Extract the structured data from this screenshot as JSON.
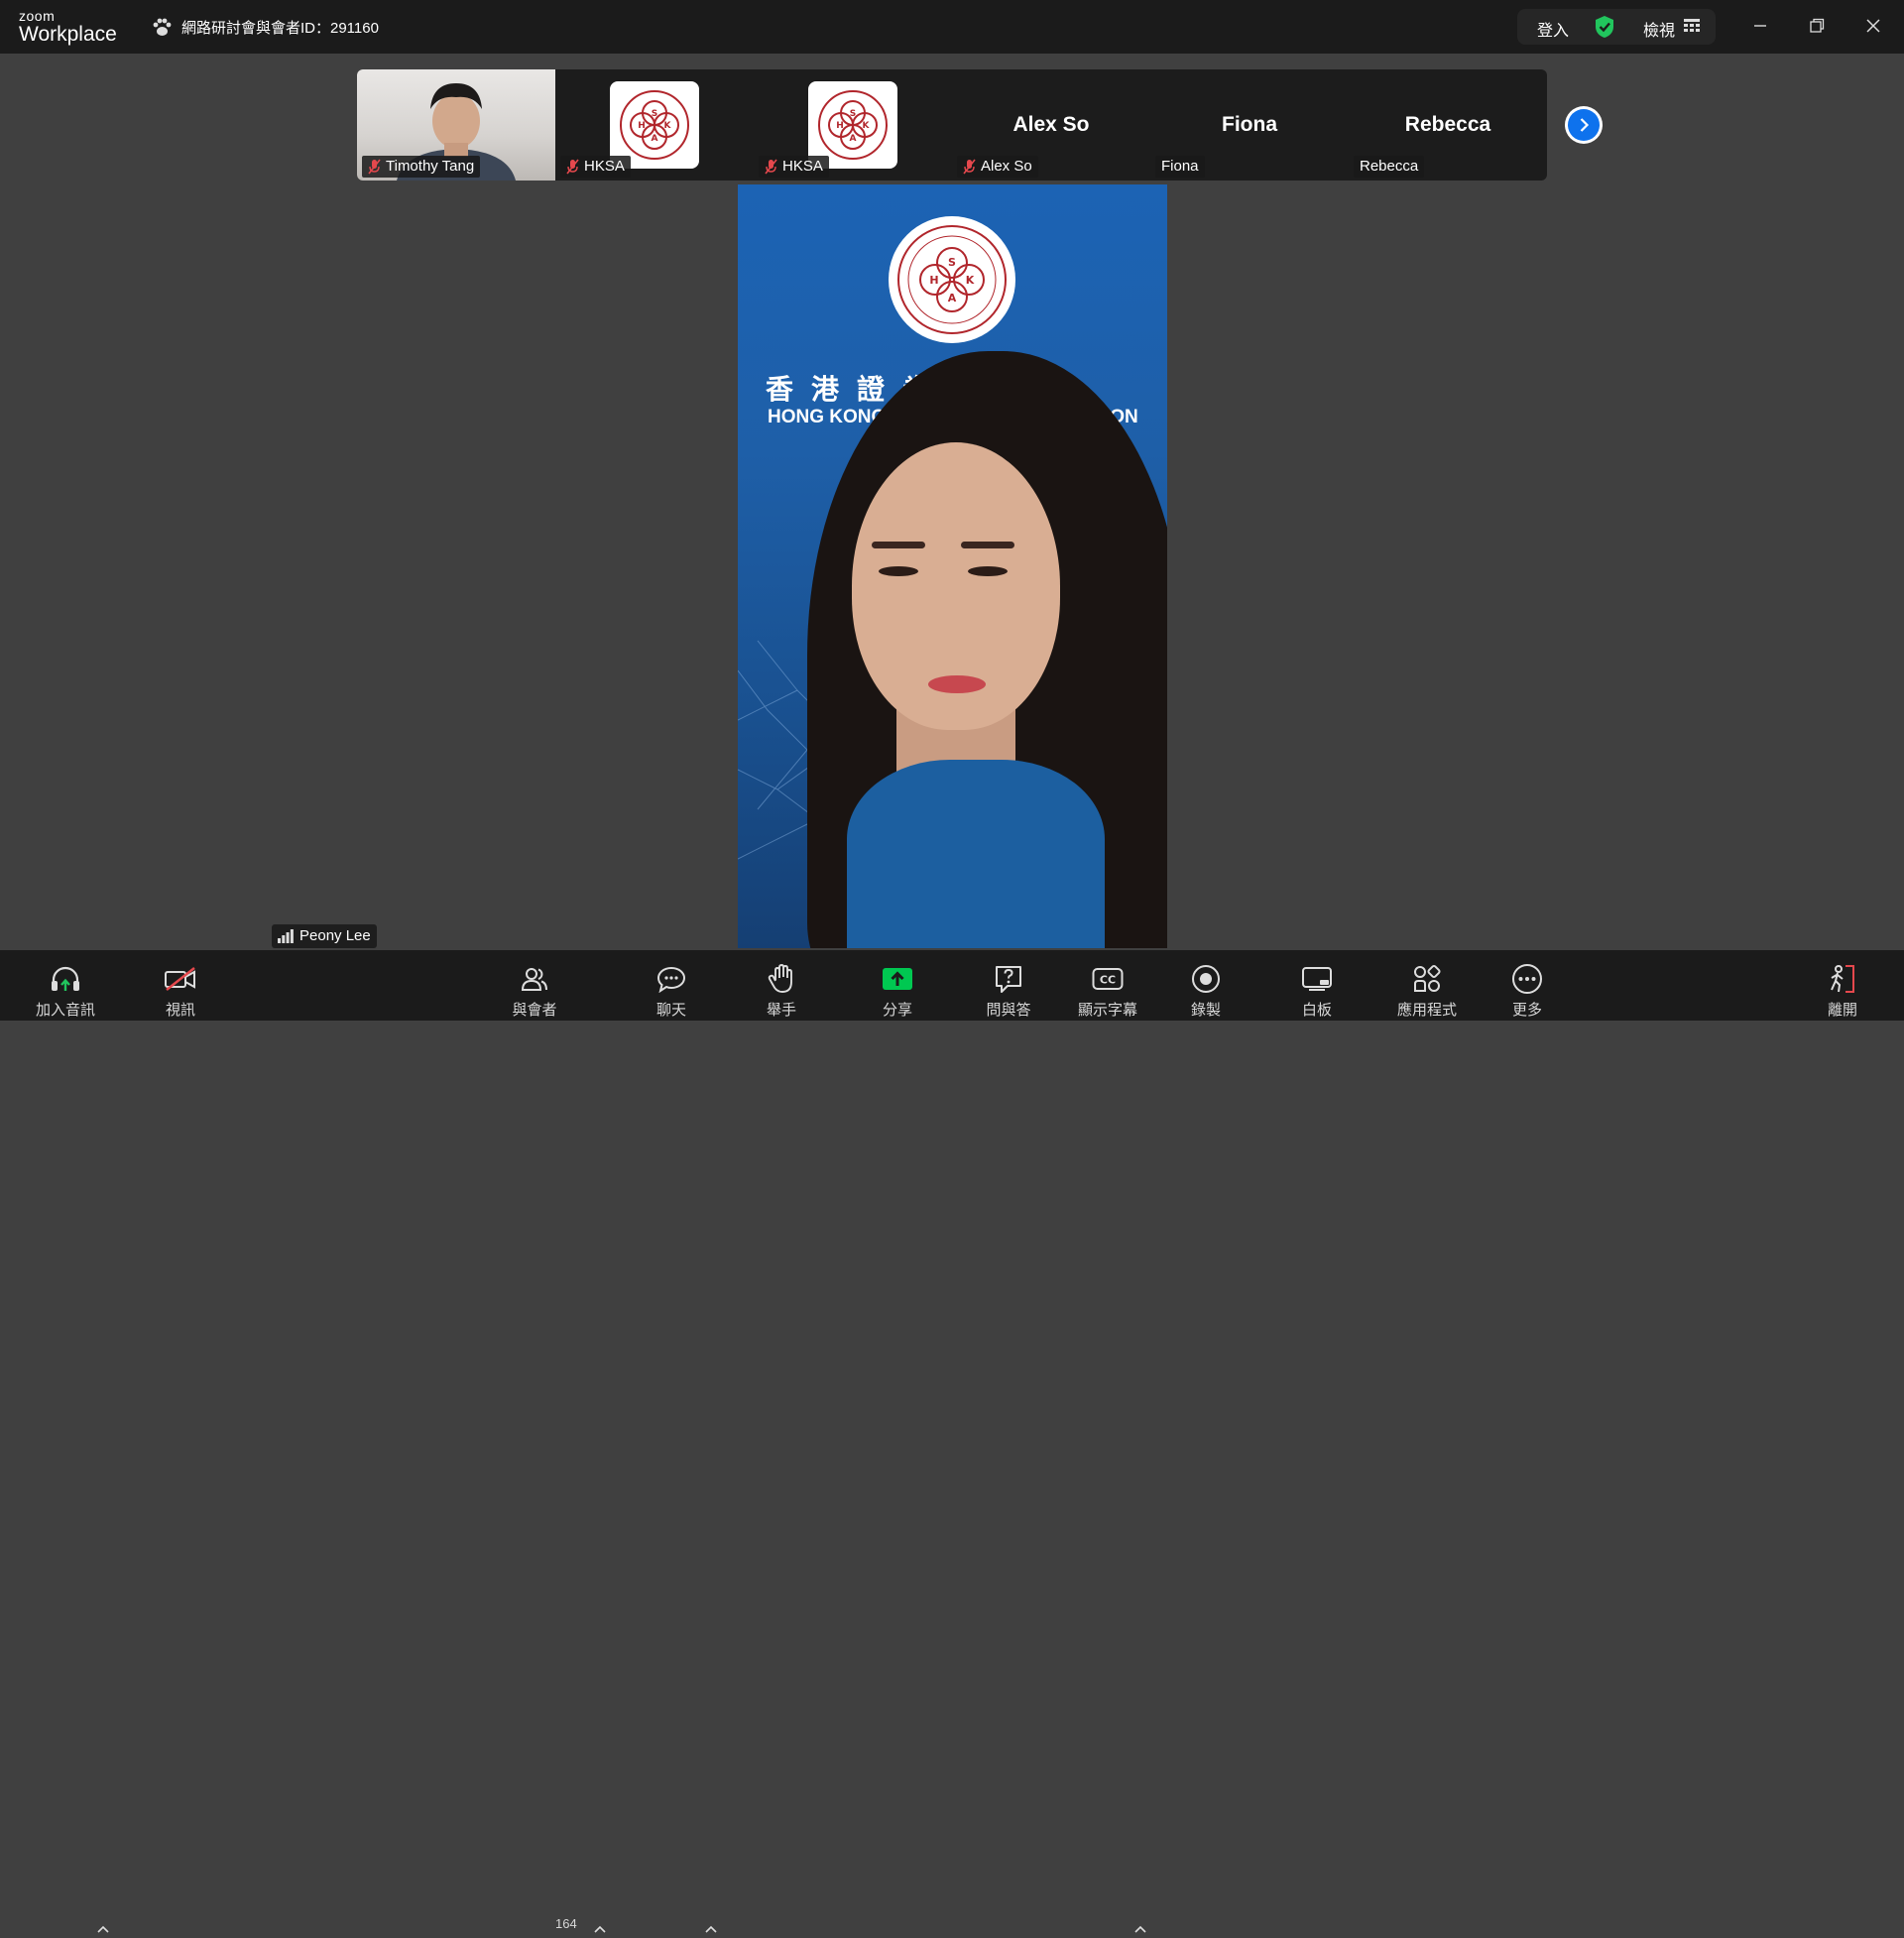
{
  "app": {
    "logo_top": "zoom",
    "logo_bottom": "Workplace",
    "meeting_title": "網路研討會與會者ID：291160",
    "signin_label": "登入",
    "view_label": "檢視"
  },
  "window_controls": [
    "minimize-icon",
    "restore-icon",
    "close-icon"
  ],
  "participants_strip": [
    {
      "name": "Timothy Tang",
      "muted": true,
      "video": "person"
    },
    {
      "name": "HKSA",
      "muted": true,
      "video": "logo"
    },
    {
      "name": "HKSA",
      "muted": true,
      "video": "logo"
    },
    {
      "name": "Alex So",
      "muted": true,
      "video": "none"
    },
    {
      "name": "Fiona",
      "muted": false,
      "video": "none"
    },
    {
      "name": "Rebecca",
      "muted": false,
      "video": "none"
    }
  ],
  "main_video": {
    "speaker_name": "Peony Lee",
    "banner_cn": "香港證券業協會",
    "banner_en": "HONG KONG SECURITIES ASSOCIATION",
    "seal_letters": [
      "S",
      "H",
      "K",
      "A"
    ]
  },
  "toolbar": {
    "join_audio": "加入音訊",
    "video": "視訊",
    "participants": "與會者",
    "participants_count": "164",
    "chat": "聊天",
    "raise_hand": "舉手",
    "share": "分享",
    "qa": "問與答",
    "captions": "顯示字幕",
    "record": "錄製",
    "whiteboard": "白板",
    "apps": "應用程式",
    "more": "更多",
    "leave": "離開"
  },
  "colors": {
    "background": "#404040",
    "bars": "#1b1b1b",
    "accent_blue": "#0e72ed",
    "share_green": "#00c851",
    "shield_green": "#21c55d",
    "muted_red": "#e5484d"
  }
}
